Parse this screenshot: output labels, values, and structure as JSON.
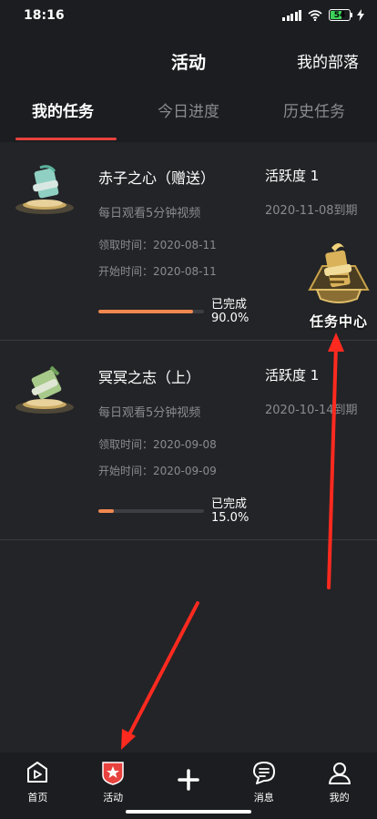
{
  "status_bar": {
    "time": "18:16",
    "battery": "54"
  },
  "header": {
    "title": "活动",
    "right_link": "我的部落"
  },
  "tabs": [
    {
      "label": "我的任务",
      "active": true
    },
    {
      "label": "今日进度",
      "active": false
    },
    {
      "label": "历史任务",
      "active": false
    }
  ],
  "tasks": [
    {
      "name": "赤子之心（赠送）",
      "description": "每日观看5分钟视频",
      "received": "领取时间：2020-08-11",
      "start": "开始时间：2020-08-11",
      "progress_label": "已完成",
      "progress_text": "90.0%",
      "progress": 90.0,
      "activity": "活跃度 1",
      "expire": "2020-11-08到期"
    },
    {
      "name": "冥冥之志（上）",
      "description": "每日观看5分钟视频",
      "received": "领取时间：2020-09-08",
      "start": "开始时间：2020-09-09",
      "progress_label": "已完成",
      "progress_text": "15.0%",
      "progress": 15.0,
      "activity": "活跃度 1",
      "expire": "2020-10-14到期"
    }
  ],
  "task_center": {
    "label": "任务中心"
  },
  "bottom_nav": [
    {
      "label": "首页",
      "icon": "home-play-icon"
    },
    {
      "label": "活动",
      "icon": "activity-star-icon"
    },
    {
      "label": "",
      "icon": "plus-icon"
    },
    {
      "label": "消息",
      "icon": "message-icon"
    },
    {
      "label": "我的",
      "icon": "profile-icon"
    }
  ],
  "colors": {
    "accent": "#e8423e",
    "progress": "#f08850",
    "background": "#232427",
    "bar": "#1c1d20",
    "arrow": "#ff2a1f"
  }
}
